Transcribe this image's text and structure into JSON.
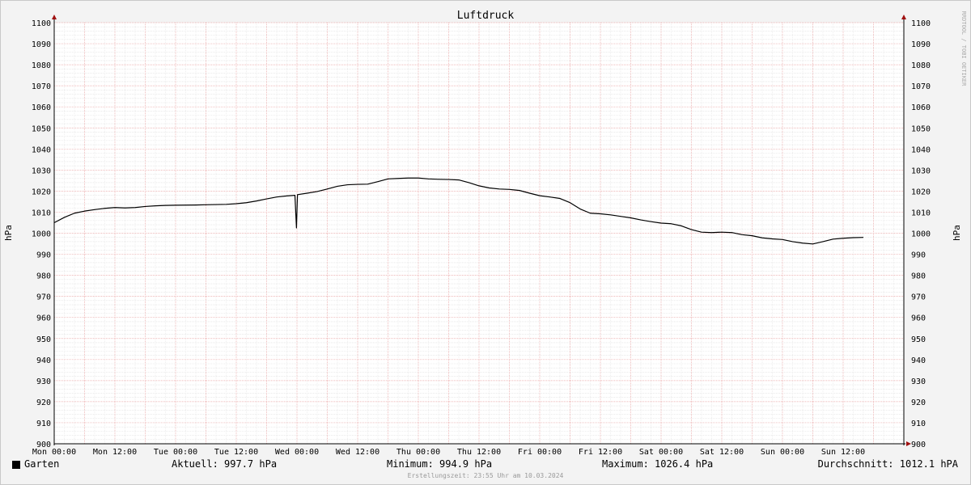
{
  "chart_data": {
    "type": "line",
    "title": "Luftdruck",
    "ylabel_left": "hPa",
    "ylabel_right": "hPa",
    "ylim": [
      900,
      1100
    ],
    "yticks": [
      900,
      910,
      920,
      930,
      940,
      950,
      960,
      970,
      980,
      990,
      1000,
      1010,
      1020,
      1030,
      1040,
      1050,
      1060,
      1070,
      1080,
      1090,
      1100
    ],
    "x_unit": "hours since Mon 00:00",
    "xlim": [
      0,
      168
    ],
    "xticks": [
      {
        "h": 0,
        "label": "Mon 00:00"
      },
      {
        "h": 12,
        "label": "Mon 12:00"
      },
      {
        "h": 24,
        "label": "Tue 00:00"
      },
      {
        "h": 36,
        "label": "Tue 12:00"
      },
      {
        "h": 48,
        "label": "Wed 00:00"
      },
      {
        "h": 60,
        "label": "Wed 12:00"
      },
      {
        "h": 72,
        "label": "Thu 00:00"
      },
      {
        "h": 84,
        "label": "Thu 12:00"
      },
      {
        "h": 96,
        "label": "Fri 00:00"
      },
      {
        "h": 108,
        "label": "Fri 12:00"
      },
      {
        "h": 120,
        "label": "Sat 00:00"
      },
      {
        "h": 132,
        "label": "Sat 12:00"
      },
      {
        "h": 144,
        "label": "Sun 00:00"
      },
      {
        "h": 156,
        "label": "Sun 12:00"
      }
    ],
    "grid": "on",
    "series": [
      {
        "name": "Garten",
        "color": "#000000",
        "points": [
          [
            0,
            1005
          ],
          [
            2,
            1007.5
          ],
          [
            4,
            1009.5
          ],
          [
            6,
            1010.5
          ],
          [
            8,
            1011.2
          ],
          [
            10,
            1011.8
          ],
          [
            12,
            1012.2
          ],
          [
            14,
            1012.0
          ],
          [
            16,
            1012.2
          ],
          [
            18,
            1012.7
          ],
          [
            20,
            1013.0
          ],
          [
            22,
            1013.2
          ],
          [
            24,
            1013.3
          ],
          [
            28,
            1013.4
          ],
          [
            30,
            1013.5
          ],
          [
            34,
            1013.7
          ],
          [
            36,
            1014.0
          ],
          [
            38,
            1014.5
          ],
          [
            40,
            1015.3
          ],
          [
            42,
            1016.3
          ],
          [
            44,
            1017.2
          ],
          [
            46,
            1017.7
          ],
          [
            47.6,
            1018.0
          ],
          [
            47.9,
            1002.5
          ],
          [
            48.1,
            1018.3
          ],
          [
            50,
            1019.0
          ],
          [
            52,
            1019.8
          ],
          [
            54,
            1021.0
          ],
          [
            56,
            1022.3
          ],
          [
            58,
            1023.0
          ],
          [
            60,
            1023.2
          ],
          [
            62,
            1023.3
          ],
          [
            64,
            1024.5
          ],
          [
            66,
            1025.8
          ],
          [
            68,
            1026.0
          ],
          [
            70,
            1026.2
          ],
          [
            72,
            1026.2
          ],
          [
            74,
            1025.8
          ],
          [
            76,
            1025.6
          ],
          [
            78,
            1025.5
          ],
          [
            80,
            1025.3
          ],
          [
            82,
            1024.0
          ],
          [
            84,
            1022.5
          ],
          [
            86,
            1021.5
          ],
          [
            88,
            1021.0
          ],
          [
            90,
            1020.8
          ],
          [
            92,
            1020.3
          ],
          [
            94,
            1019.0
          ],
          [
            96,
            1017.8
          ],
          [
            98,
            1017.2
          ],
          [
            100,
            1016.5
          ],
          [
            102,
            1014.5
          ],
          [
            104,
            1011.5
          ],
          [
            106,
            1009.5
          ],
          [
            108,
            1009.2
          ],
          [
            110,
            1008.7
          ],
          [
            112,
            1008.0
          ],
          [
            114,
            1007.3
          ],
          [
            116,
            1006.3
          ],
          [
            118,
            1005.5
          ],
          [
            120,
            1004.8
          ],
          [
            122,
            1004.5
          ],
          [
            124,
            1003.5
          ],
          [
            126,
            1001.7
          ],
          [
            128,
            1000.5
          ],
          [
            130,
            1000.3
          ],
          [
            132,
            1000.5
          ],
          [
            134,
            1000.3
          ],
          [
            136,
            999.3
          ],
          [
            138,
            998.8
          ],
          [
            140,
            997.8
          ],
          [
            142,
            997.3
          ],
          [
            144,
            997.0
          ],
          [
            146,
            996.0
          ],
          [
            148,
            995.3
          ],
          [
            150,
            994.9
          ],
          [
            152,
            996.0
          ],
          [
            154,
            997.2
          ],
          [
            156,
            997.6
          ],
          [
            158,
            997.9
          ],
          [
            160,
            998.0
          ]
        ]
      }
    ]
  },
  "watermark": "RRDTOOL / TOBI OETIKER",
  "legend": {
    "series_name": "Garten",
    "current": "Aktuell: 997.7 hPa",
    "minimum": "Minimum: 994.9 hPa",
    "maximum": "Maximum: 1026.4 hPa",
    "average": "Durchschnitt: 1012.1 hPA"
  },
  "footer": "Erstellungszeit: 23:55 Uhr am 10.03.2024"
}
